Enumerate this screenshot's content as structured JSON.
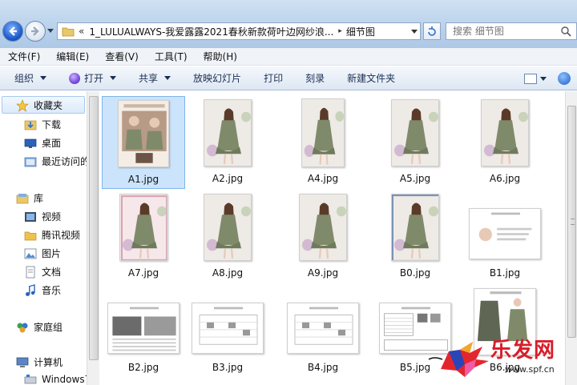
{
  "address": {
    "path": "LULUALWAYS-我爱露露2021春秋新款荷叶边网纱浪...",
    "prefix": "1_",
    "current": "细节图",
    "back_marks": "«",
    "sep": "▸"
  },
  "search": {
    "placeholder": "搜索 细节图"
  },
  "menu": [
    "文件(F)",
    "编辑(E)",
    "查看(V)",
    "工具(T)",
    "帮助(H)"
  ],
  "commands": [
    {
      "label": "组织",
      "dropdown": true
    },
    {
      "label": "打开",
      "dropdown": true,
      "icon": "open-icon"
    },
    {
      "label": "共享",
      "dropdown": true
    },
    {
      "label": "放映幻灯片",
      "dropdown": false
    },
    {
      "label": "打印",
      "dropdown": false
    },
    {
      "label": "刻录",
      "dropdown": false
    },
    {
      "label": "新建文件夹",
      "dropdown": false
    }
  ],
  "nav": {
    "favorites": "收藏夹",
    "favorites_items": [
      "下载",
      "桌面",
      "最近访问的"
    ],
    "libraries": "库",
    "library_items": [
      "视频",
      "腾讯视频",
      "图片",
      "文档",
      "音乐"
    ],
    "homegroup": "家庭组",
    "computer": "计算机",
    "computer_items": [
      "Windows7"
    ]
  },
  "files": [
    {
      "name": "A1.jpg",
      "kind": "collage",
      "selected": true
    },
    {
      "name": "A2.jpg",
      "kind": "photo"
    },
    {
      "name": "A4.jpg",
      "kind": "photo-tall"
    },
    {
      "name": "A5.jpg",
      "kind": "photo"
    },
    {
      "name": "A6.jpg",
      "kind": "photo"
    },
    {
      "name": "A7.jpg",
      "kind": "photo-border"
    },
    {
      "name": "A8.jpg",
      "kind": "photo"
    },
    {
      "name": "A9.jpg",
      "kind": "photo"
    },
    {
      "name": "B0.jpg",
      "kind": "photo-frame"
    },
    {
      "name": "B1.jpg",
      "kind": "doc-card"
    },
    {
      "name": "B2.jpg",
      "kind": "doc-image"
    },
    {
      "name": "B3.jpg",
      "kind": "doc-table"
    },
    {
      "name": "B4.jpg",
      "kind": "doc-table"
    },
    {
      "name": "B5.jpg",
      "kind": "doc-size"
    },
    {
      "name": "B6.jpg",
      "kind": "photo-pair"
    }
  ],
  "colors": {
    "dress": "#7f8a6a",
    "selection": "#cce4fb",
    "watermark": "#d81d2a"
  },
  "watermark": {
    "text": "乐发网",
    "url": "www.spf.cn"
  }
}
